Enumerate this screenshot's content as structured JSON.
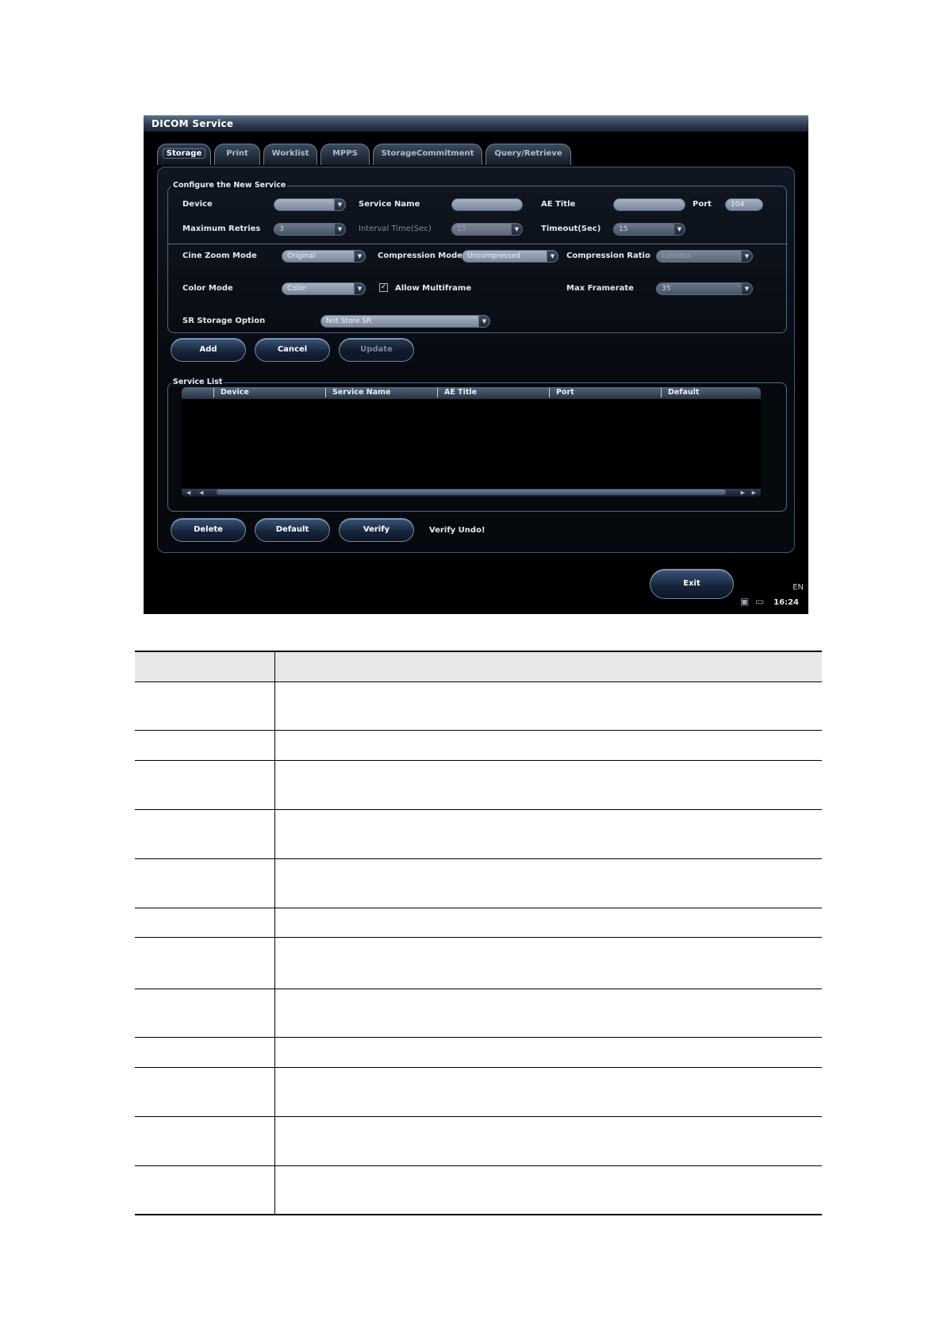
{
  "window": {
    "title": "DICOM Service",
    "tabs": [
      "Storage",
      "Print",
      "Worklist",
      "MPPS",
      "StorageCommitment",
      "Query/Retrieve"
    ],
    "active_tab": "Storage"
  },
  "configure": {
    "legend": "Configure the New Service",
    "device_label": "Device",
    "device_value": "",
    "service_name_label": "Service Name",
    "service_name_value": "",
    "ae_title_label": "AE Title",
    "ae_title_value": "",
    "port_label": "Port",
    "port_value": "104",
    "max_retries_label": "Maximum Retries",
    "max_retries_value": "3",
    "interval_label": "Interval Time(Sec)",
    "interval_value": "15",
    "timeout_label": "Timeout(Sec)",
    "timeout_value": "15",
    "cine_zoom_label": "Cine Zoom Mode",
    "cine_zoom_value": "Original",
    "compression_mode_label": "Compression Mode",
    "compression_mode_value": "Uncompressed",
    "compression_ratio_label": "Compression Ratio",
    "compression_ratio_value": "Lossless",
    "color_mode_label": "Color Mode",
    "color_mode_value": "Color",
    "allow_multiframe_label": "Allow Multiframe",
    "allow_multiframe_checked": "✓",
    "max_framerate_label": "Max Framerate",
    "max_framerate_value": "35",
    "sr_option_label": "SR Storage Option",
    "sr_option_value": "Not Store SR"
  },
  "actions": {
    "add": "Add",
    "cancel": "Cancel",
    "update": "Update"
  },
  "service_list": {
    "legend": "Service List",
    "columns": [
      "Device",
      "Service Name",
      "AE Title",
      "Port",
      "Default"
    ],
    "rows": []
  },
  "bottom_actions": {
    "delete": "Delete",
    "default": "Default",
    "verify": "Verify",
    "verify_status": "Verify Undo!"
  },
  "exit": "Exit",
  "status": {
    "language": "EN",
    "time": "16:24"
  },
  "doc_table": {
    "rows": 12
  }
}
